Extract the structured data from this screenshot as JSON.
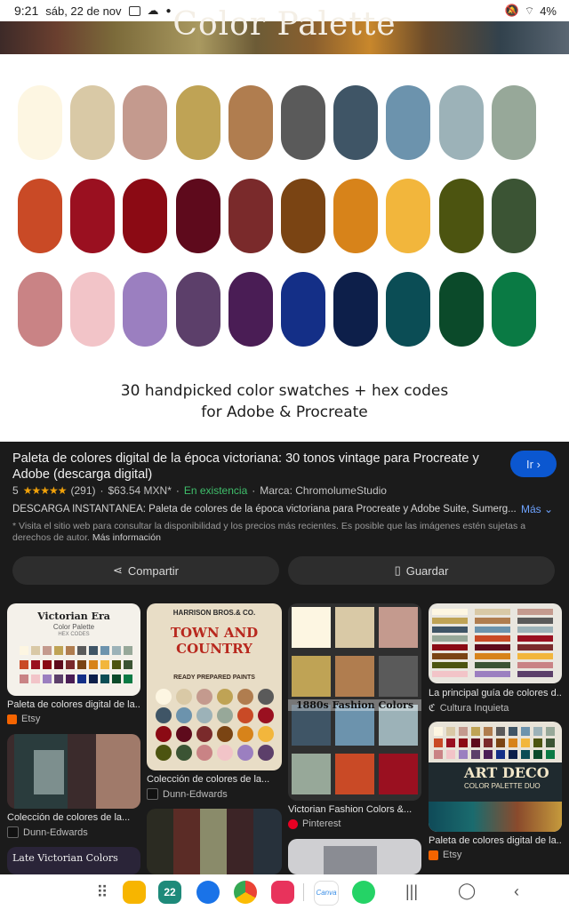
{
  "status_bar": {
    "time": "9:21",
    "date": "sáb, 22 de nov",
    "battery": "4%",
    "icons": [
      "gallery-icon",
      "cloud-icon",
      "dot-icon",
      "mute-icon",
      "wifi-icon",
      "battery-icon"
    ]
  },
  "banner": {
    "title": "Color Palette"
  },
  "palette": {
    "swatches": [
      [
        "#fdf6e2",
        "#d9c9a6",
        "#c49a8e",
        "#bfa355",
        "#b07d4f",
        "#5a5a5a",
        "#3f5566",
        "#6c93ad",
        "#9cb2b8",
        "#97a899"
      ],
      [
        "#c94a26",
        "#9a1020",
        "#8b0a14",
        "#5e0a1c",
        "#7a2a2b",
        "#7a4413",
        "#d7831a",
        "#f2b63c",
        "#4c5410",
        "#3b5434"
      ],
      [
        "#c98385",
        "#f2c4c8",
        "#9b7fc0",
        "#5c3f6a",
        "#4a1d55",
        "#142f87",
        "#0d1f4a",
        "#0b4d55",
        "#0b4a2a",
        "#0a7a44"
      ]
    ],
    "caption_line1": "30 handpicked color swatches + hex codes",
    "caption_line2": "for Adobe & Procreate"
  },
  "result": {
    "title": "Paleta de colores digital de la época victoriana: 30 tonos vintage para Procreate y Adobe (descarga digital)",
    "go_label": "Ir",
    "rating": "5",
    "stars": "★★★★★",
    "reviews": "(291)",
    "price": "$63.54 MXN*",
    "stock": "En existencia",
    "brand": "Marca: ChromolumeStudio",
    "description": "DESCARGA INSTANTÁNEA: Paleta de colores de la época victoriana para Procreate y Adobe Suite, Sumerg...",
    "more_label": "Más",
    "note": "* Visita el sitio web para consultar la disponibilidad y los precios más recientes. Es posible que las imágenes estén sujetas a derechos de autor.",
    "note_link": "Más información",
    "share_label": "Compartir",
    "save_label": "Guardar"
  },
  "related": [
    {
      "label": "Paleta de colores digital de la...",
      "source": "Etsy",
      "thumb_title": "Victorian Era",
      "thumb_sub": "Color Palette",
      "thumb_code": "HEX CODES",
      "color": "#f56400"
    },
    {
      "label": "Colección de colores de la...",
      "source": "Dunn-Edwards",
      "thumb_title": "TOWN AND COUNTRY",
      "thumb_sub": "HARRISON BROS.& CO.",
      "thumb_code": "READY PREPARED PAINTS",
      "color": "#222"
    },
    {
      "label": "Victorian Fashion Colors &...",
      "source": "Pinterest",
      "thumb_title": "1880s Fashion Colors",
      "color": "#e60023"
    },
    {
      "label": "La principal guía de colores d...",
      "source": "Cultura Inquieta",
      "color": "#111"
    },
    {
      "label": "Colección de colores de la...",
      "source": "Dunn-Edwards",
      "color": "#222"
    },
    {
      "label": "Paleta de colores digital de la...",
      "source": "Etsy",
      "thumb_title": "ART DECO",
      "thumb_sub": "COLOR PALETTE DUO",
      "color": "#f56400"
    },
    {
      "thumb_title": "Late Victorian Colors"
    }
  ],
  "nav": {
    "calendar_day": "22",
    "apps": [
      "apps-grid-icon",
      "files-icon",
      "calendar-icon",
      "messages-icon",
      "chrome-icon",
      "screen-recorder-icon",
      "canva-icon",
      "whatsapp-icon"
    ],
    "canva_label": "Canva"
  }
}
